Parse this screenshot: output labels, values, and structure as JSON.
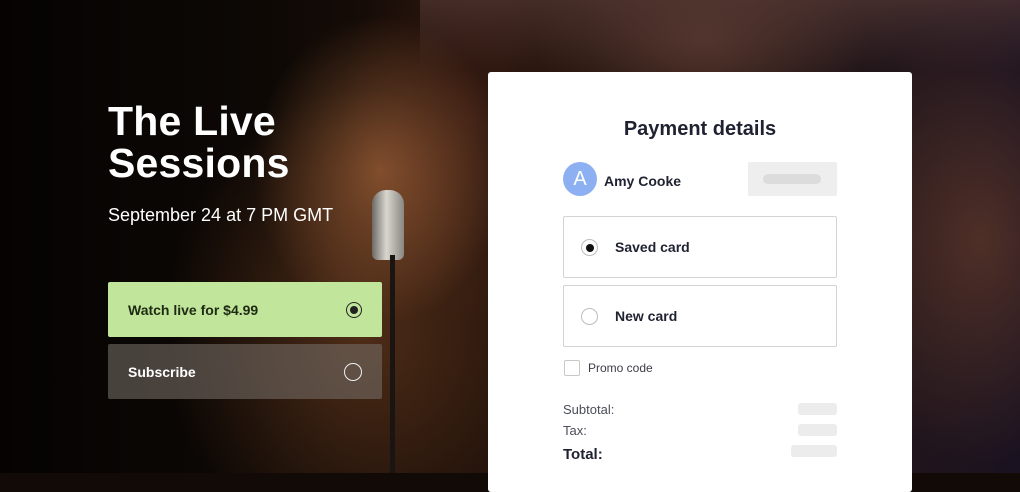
{
  "hero": {
    "title": "The Live Sessions",
    "date": "September 24 at 7 PM GMT"
  },
  "options": {
    "watch_label": "Watch live for $4.99",
    "watch_selected": true,
    "subscribe_label": "Subscribe",
    "subscribe_selected": false
  },
  "payment": {
    "title": "Payment details",
    "user": {
      "initial": "A",
      "name": "Amy Cooke"
    },
    "methods": [
      {
        "label": "Saved card",
        "selected": true
      },
      {
        "label": "New card",
        "selected": false
      }
    ],
    "promo_label": "Promo code",
    "promo_checked": false,
    "summary": {
      "subtotal_label": "Subtotal:",
      "tax_label": "Tax:",
      "total_label": "Total:"
    }
  },
  "colors": {
    "watch_bg": "#c2e59c",
    "avatar_bg": "#8cb0f2",
    "card_bg": "#ffffff"
  },
  "icons": [
    "radio-selected-icon",
    "radio-empty-icon",
    "checkbox-icon"
  ]
}
